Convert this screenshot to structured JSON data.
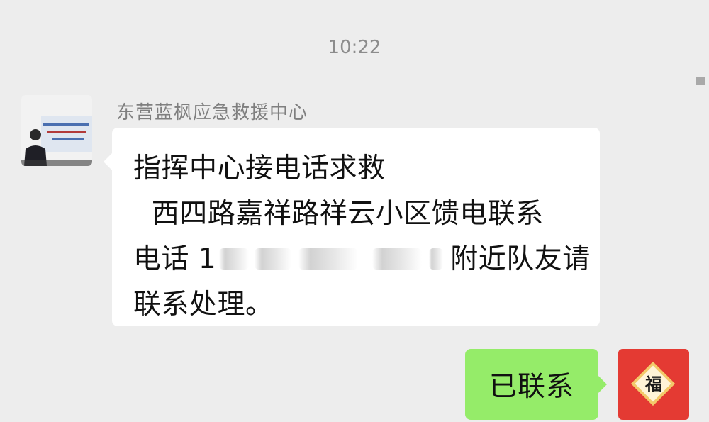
{
  "chat": {
    "timestamp": "10:22",
    "incoming": {
      "sender": "东营蓝枫应急救援中心",
      "avatar_icon": "person-banner-avatar",
      "line1": "指挥中心接电话求救",
      "line2": "  西四路嘉祥路祥云小区馈电联系",
      "line3_prefix": "电话 1",
      "line3_suffix": "附近队友请",
      "line4": "联系处理。"
    },
    "outgoing": {
      "text": "已联系",
      "avatar_icon": "fu-red-envelope-avatar",
      "avatar_text": "福"
    }
  },
  "colors": {
    "background": "#ededed",
    "incoming_bubble": "#ffffff",
    "outgoing_bubble": "#95ec69",
    "avatar_red": "#e43a33",
    "gold": "#f3c96a"
  }
}
